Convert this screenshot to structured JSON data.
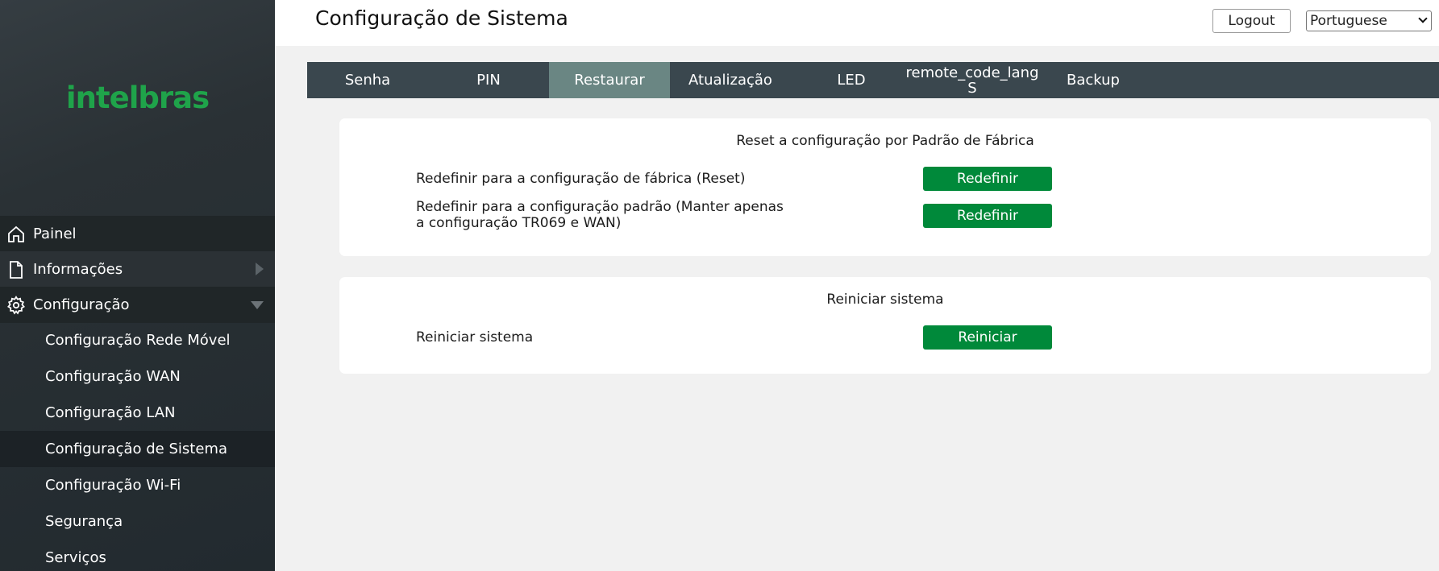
{
  "brand": {
    "logo_text": "intelbras",
    "logo_color": "#1fa34a"
  },
  "header": {
    "title": "Configuração de Sistema",
    "logout_label": "Logout",
    "language_selected": "Portuguese"
  },
  "sidebar": {
    "top_items": [
      {
        "label": "Painel",
        "icon": "home-icon"
      },
      {
        "label": "Informações",
        "icon": "document-icon",
        "expand": "chevron-right-icon"
      },
      {
        "label": "Configuração",
        "icon": "gear-icon",
        "expand": "chevron-down-icon",
        "expanded": true
      }
    ],
    "sub_items": [
      {
        "label": "Configuração Rede Móvel"
      },
      {
        "label": "Configuração WAN"
      },
      {
        "label": "Configuração LAN"
      },
      {
        "label": "Configuração de Sistema",
        "active": true
      },
      {
        "label": "Configuração Wi-Fi"
      },
      {
        "label": "Segurança"
      },
      {
        "label": "Serviços"
      }
    ]
  },
  "tabs": [
    {
      "label": "Senha"
    },
    {
      "label": "PIN"
    },
    {
      "label": "Restaurar",
      "active": true
    },
    {
      "label": "Atualização"
    },
    {
      "label": "LED"
    },
    {
      "label": "remote_code_lang\nS"
    },
    {
      "label": "Backup"
    }
  ],
  "reset_card": {
    "title": "Reset a configuração por Padrão de Fábrica",
    "rows": [
      {
        "label": "Redefinir para a configuração de fábrica (Reset)",
        "button": "Redefinir"
      },
      {
        "label": "Redefinir para a configuração padrão (Manter apenas a configuração TR069 e WAN)",
        "button": "Redefinir"
      }
    ]
  },
  "reboot_card": {
    "title": "Reiniciar sistema",
    "rows": [
      {
        "label": "Reiniciar sistema",
        "button": "Reiniciar"
      }
    ]
  },
  "colors": {
    "accent_green": "#00893a",
    "tab_bar": "#3a474e",
    "tab_active": "#6a8683",
    "sidebar": "#2a3135"
  }
}
